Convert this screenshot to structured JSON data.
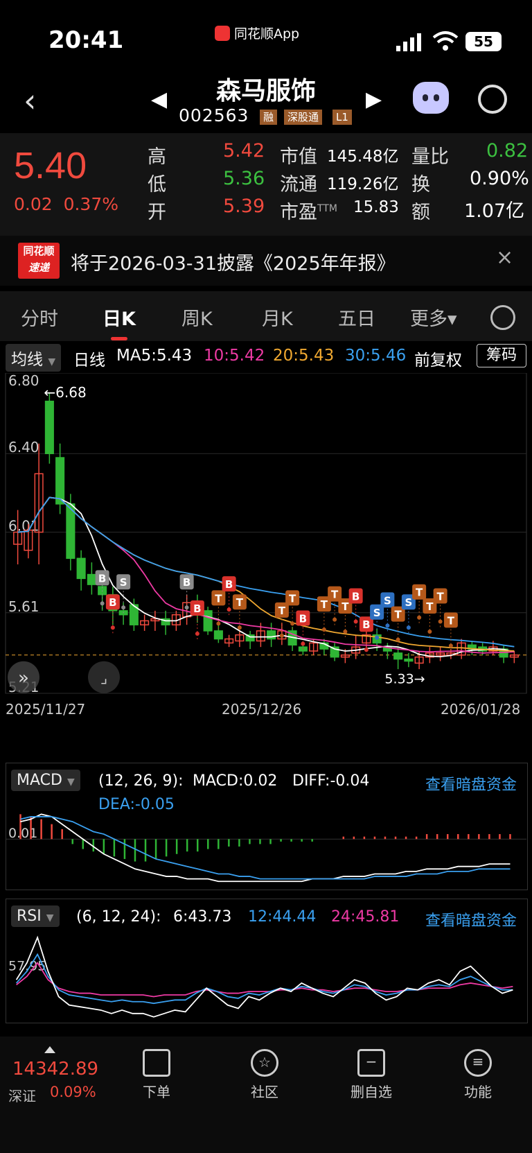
{
  "status": {
    "time": "20:41",
    "app": "同花顺App",
    "battery": "55"
  },
  "stock": {
    "name": "森马服饰",
    "code": "002563",
    "tags": [
      "融",
      "深股通",
      "L1"
    ]
  },
  "quote": {
    "price": "5.40",
    "change": "0.02",
    "change_pct": "0.37%",
    "rows": [
      {
        "l1": "高",
        "v1": "5.42",
        "l2": "市值",
        "v2": "145.48亿",
        "l3": "量比",
        "v3": "0.82"
      },
      {
        "l1": "低",
        "v1": "5.36",
        "l2": "流通",
        "v2": "119.26亿",
        "l3": "换",
        "v3": "0.90%"
      },
      {
        "l1": "开",
        "v1": "5.39",
        "l2": "市盈",
        "l2sup": "TTM",
        "v2": "15.83",
        "l3": "额",
        "v3": "1.07亿"
      }
    ]
  },
  "news": {
    "logo_top": "同花顺",
    "logo_bottom": "速递",
    "text": "将于2026-03-31披露《2025年年报》",
    "close": "×"
  },
  "tabs": [
    "分时",
    "日K",
    "周K",
    "月K",
    "五日",
    "更多▾"
  ],
  "ma": {
    "selector": "均线",
    "label": "日线",
    "ma5": "MA5:5.43",
    "ma10": "10:5.42",
    "ma20": "20:5.43",
    "ma30": "30:5.46",
    "adj": "前复权",
    "chips": "筹码"
  },
  "kline": {
    "y_labels": [
      "6.80",
      "6.40",
      "6.01",
      "5.61",
      "5.21"
    ],
    "high_note": "←6.68",
    "low_note": "5.33→",
    "dates": [
      "2025/11/27",
      "2025/12/26",
      "2026/01/28"
    ],
    "colors": {
      "up": "#f04a3e",
      "down": "#2fb535",
      "ma5": "#ffffff",
      "ma10": "#ee3aa4",
      "ma20": "#f0a830",
      "ma30": "#3aa0f0"
    }
  },
  "chart_data": {
    "type": "candlestick",
    "ylim": [
      5.21,
      6.8
    ],
    "candles": [
      [
        5.95,
        6.01,
        5.85,
        6.12
      ],
      [
        5.92,
        6.02,
        5.88,
        6.05
      ],
      [
        6.01,
        6.3,
        5.85,
        6.45
      ],
      [
        6.66,
        6.4,
        6.35,
        6.7
      ],
      [
        6.38,
        6.15,
        6.1,
        6.45
      ],
      [
        6.15,
        5.88,
        5.82,
        6.2
      ],
      [
        5.88,
        5.78,
        5.72,
        5.92
      ],
      [
        5.8,
        5.75,
        5.7,
        5.86
      ],
      [
        5.74,
        5.7,
        5.62,
        5.78
      ],
      [
        5.7,
        5.62,
        5.55,
        5.74
      ],
      [
        5.62,
        5.6,
        5.55,
        5.66
      ],
      [
        5.65,
        5.55,
        5.52,
        5.68
      ],
      [
        5.55,
        5.57,
        5.52,
        5.6
      ],
      [
        5.57,
        5.58,
        5.52,
        5.62
      ],
      [
        5.58,
        5.55,
        5.5,
        5.62
      ],
      [
        5.55,
        5.6,
        5.52,
        5.62
      ],
      [
        5.59,
        5.66,
        5.55,
        5.7
      ],
      [
        5.66,
        5.62,
        5.56,
        5.7
      ],
      [
        5.62,
        5.52,
        5.5,
        5.64
      ],
      [
        5.52,
        5.48,
        5.46,
        5.55
      ],
      [
        5.46,
        5.48,
        5.44,
        5.5
      ],
      [
        5.47,
        5.5,
        5.44,
        5.52
      ],
      [
        5.5,
        5.47,
        5.43,
        5.52
      ],
      [
        5.47,
        5.52,
        5.44,
        5.56
      ],
      [
        5.52,
        5.48,
        5.44,
        5.56
      ],
      [
        5.48,
        5.52,
        5.45,
        5.56
      ],
      [
        5.52,
        5.45,
        5.42,
        5.54
      ],
      [
        5.44,
        5.42,
        5.4,
        5.46
      ],
      [
        5.42,
        5.46,
        5.4,
        5.48
      ],
      [
        5.46,
        5.43,
        5.4,
        5.48
      ],
      [
        5.44,
        5.39,
        5.37,
        5.46
      ],
      [
        5.39,
        5.4,
        5.36,
        5.43
      ],
      [
        5.41,
        5.44,
        5.38,
        5.5
      ],
      [
        5.46,
        5.5,
        5.42,
        5.54
      ],
      [
        5.5,
        5.46,
        5.42,
        5.53
      ],
      [
        5.44,
        5.42,
        5.38,
        5.46
      ],
      [
        5.41,
        5.38,
        5.33,
        5.44
      ],
      [
        5.38,
        5.37,
        5.34,
        5.41
      ],
      [
        5.36,
        5.39,
        5.33,
        5.42
      ],
      [
        5.39,
        5.41,
        5.36,
        5.44
      ],
      [
        5.4,
        5.41,
        5.37,
        5.44
      ],
      [
        5.4,
        5.41,
        5.38,
        5.43
      ],
      [
        5.4,
        5.46,
        5.38,
        5.48
      ],
      [
        5.45,
        5.43,
        5.4,
        5.47
      ],
      [
        5.44,
        5.42,
        5.4,
        5.46
      ],
      [
        5.42,
        5.44,
        5.4,
        5.47
      ],
      [
        5.43,
        5.39,
        5.36,
        5.45
      ],
      [
        5.39,
        5.4,
        5.36,
        5.42
      ]
    ],
    "markers": [
      {
        "i": 8,
        "t": "B",
        "k": "gray",
        "p": 5.78
      },
      {
        "i": 9,
        "t": "B",
        "k": "red",
        "p": 5.66
      },
      {
        "i": 10,
        "t": "S",
        "k": "gray",
        "p": 5.76
      },
      {
        "i": 16,
        "t": "B",
        "k": "gray",
        "p": 5.76
      },
      {
        "i": 17,
        "t": "B",
        "k": "red",
        "p": 5.63
      },
      {
        "i": 19,
        "t": "T",
        "k": "orange",
        "p": 5.68
      },
      {
        "i": 20,
        "t": "B",
        "k": "red",
        "p": 5.75
      },
      {
        "i": 21,
        "t": "T",
        "k": "orange",
        "p": 5.66
      },
      {
        "i": 25,
        "t": "T",
        "k": "orange",
        "p": 5.62
      },
      {
        "i": 26,
        "t": "T",
        "k": "orange",
        "p": 5.68
      },
      {
        "i": 27,
        "t": "B",
        "k": "red",
        "p": 5.58
      },
      {
        "i": 29,
        "t": "T",
        "k": "orange",
        "p": 5.65
      },
      {
        "i": 30,
        "t": "T",
        "k": "orange",
        "p": 5.7
      },
      {
        "i": 31,
        "t": "T",
        "k": "orange",
        "p": 5.64
      },
      {
        "i": 32,
        "t": "B",
        "k": "red",
        "p": 5.69
      },
      {
        "i": 33,
        "t": "B",
        "k": "red",
        "p": 5.55
      },
      {
        "i": 34,
        "t": "S",
        "k": "blue",
        "p": 5.61
      },
      {
        "i": 35,
        "t": "S",
        "k": "blue",
        "p": 5.67
      },
      {
        "i": 36,
        "t": "T",
        "k": "orange",
        "p": 5.6
      },
      {
        "i": 37,
        "t": "S",
        "k": "blue",
        "p": 5.66
      },
      {
        "i": 38,
        "t": "T",
        "k": "orange",
        "p": 5.71
      },
      {
        "i": 39,
        "t": "T",
        "k": "orange",
        "p": 5.64
      },
      {
        "i": 40,
        "t": "T",
        "k": "orange",
        "p": 5.69
      },
      {
        "i": 41,
        "t": "T",
        "k": "orange",
        "p": 5.57
      }
    ]
  },
  "macd": {
    "selector": "MACD",
    "params": "(12, 26, 9):",
    "macd": "MACD:0.02",
    "diff": "DIFF:-0.04",
    "dea": "DEA:-0.05",
    "link": "查看暗盘资金",
    "y_label": "0.01",
    "bars": [
      0.1,
      0.09,
      0.08,
      0.06,
      0.04,
      -0.02,
      -0.04,
      -0.05,
      -0.06,
      -0.07,
      -0.08,
      -0.09,
      -0.09,
      -0.08,
      -0.07,
      -0.06,
      -0.05,
      -0.05,
      -0.04,
      -0.04,
      -0.03,
      -0.03,
      -0.02,
      -0.02,
      -0.02,
      -0.01,
      -0.01,
      -0.01,
      -0.01,
      0.0,
      0.0,
      0.01,
      0.01,
      0.01,
      0.01,
      0.01,
      0.01,
      0.01,
      0.01,
      0.02,
      0.02,
      0.02,
      0.02,
      0.02,
      0.02,
      0.02,
      0.02,
      0.02
    ],
    "diff_line": [
      0.07,
      0.08,
      0.1,
      0.09,
      0.06,
      0.03,
      0.0,
      -0.03,
      -0.06,
      -0.08,
      -0.1,
      -0.12,
      -0.13,
      -0.14,
      -0.15,
      -0.15,
      -0.16,
      -0.16,
      -0.16,
      -0.17,
      -0.17,
      -0.17,
      -0.17,
      -0.17,
      -0.17,
      -0.17,
      -0.17,
      -0.17,
      -0.16,
      -0.16,
      -0.16,
      -0.15,
      -0.15,
      -0.15,
      -0.14,
      -0.14,
      -0.14,
      -0.13,
      -0.13,
      -0.12,
      -0.12,
      -0.12,
      -0.11,
      -0.11,
      -0.11,
      -0.1,
      -0.1,
      -0.1
    ],
    "dea_line": [
      0.08,
      0.09,
      0.09,
      0.09,
      0.08,
      0.07,
      0.05,
      0.03,
      0.02,
      0.0,
      -0.02,
      -0.04,
      -0.06,
      -0.08,
      -0.09,
      -0.1,
      -0.11,
      -0.12,
      -0.13,
      -0.14,
      -0.14,
      -0.15,
      -0.15,
      -0.16,
      -0.16,
      -0.16,
      -0.16,
      -0.16,
      -0.16,
      -0.16,
      -0.16,
      -0.16,
      -0.16,
      -0.16,
      -0.15,
      -0.15,
      -0.15,
      -0.15,
      -0.14,
      -0.14,
      -0.14,
      -0.13,
      -0.13,
      -0.13,
      -0.12,
      -0.12,
      -0.12,
      -0.12
    ]
  },
  "rsi": {
    "selector": "RSI",
    "params": "(6, 12, 24):",
    "r6": "6:43.73",
    "r12": "12:44.44",
    "r24": "24:45.81",
    "link": "查看暗盘资金",
    "y_label": "57.95",
    "r6_line": [
      50,
      60,
      75,
      55,
      40,
      35,
      34,
      33,
      32,
      30,
      32,
      30,
      30,
      28,
      30,
      32,
      31,
      38,
      45,
      40,
      35,
      33,
      40,
      38,
      42,
      45,
      43,
      48,
      45,
      42,
      40,
      45,
      50,
      48,
      42,
      38,
      40,
      45,
      44,
      48,
      50,
      47,
      55,
      58,
      52,
      46,
      42,
      44
    ],
    "r12_line": [
      48,
      55,
      65,
      52,
      44,
      41,
      40,
      39,
      38,
      37,
      38,
      37,
      37,
      36,
      37,
      38,
      38,
      42,
      45,
      43,
      40,
      39,
      42,
      41,
      43,
      45,
      44,
      46,
      45,
      43,
      42,
      44,
      47,
      46,
      43,
      41,
      42,
      44,
      44,
      46,
      47,
      46,
      50,
      52,
      49,
      46,
      44,
      44
    ],
    "r24_line": [
      47,
      52,
      60,
      50,
      45,
      43,
      42,
      42,
      41,
      41,
      41,
      41,
      41,
      40,
      41,
      41,
      41,
      43,
      44,
      43,
      42,
      42,
      43,
      43,
      43,
      44,
      44,
      45,
      44,
      44,
      43,
      44,
      45,
      45,
      44,
      43,
      43,
      44,
      44,
      45,
      45,
      45,
      47,
      48,
      47,
      46,
      45,
      46
    ]
  },
  "bottom": {
    "index_value": "14342.89",
    "index_name": "深证",
    "index_pct": "0.09%",
    "items": [
      "下单",
      "社区",
      "删自选",
      "功能"
    ]
  }
}
